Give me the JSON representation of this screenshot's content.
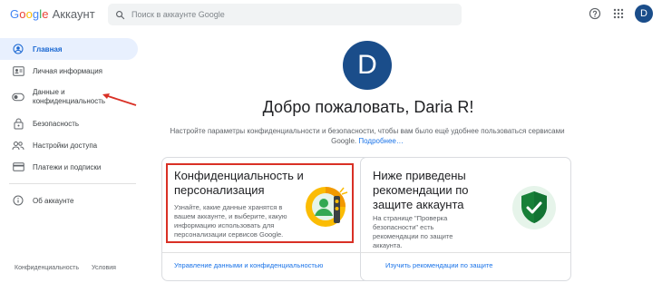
{
  "header": {
    "logo_google": "Google",
    "logo_account": "Аккаунт",
    "search_placeholder": "Поиск в аккаунте Google",
    "avatar_letter": "D"
  },
  "sidebar": {
    "items": [
      {
        "label": "Главная",
        "icon": "person-circle-icon",
        "active": true
      },
      {
        "label": "Личная информация",
        "icon": "id-card-icon"
      },
      {
        "label": "Данные и\nконфиденциальность",
        "icon": "toggle-icon"
      },
      {
        "label": "Безопасность",
        "icon": "lock-icon"
      },
      {
        "label": "Настройки доступа",
        "icon": "people-icon"
      },
      {
        "label": "Платежи и подписки",
        "icon": "credit-card-icon"
      },
      {
        "label": "Об аккаунте",
        "icon": "info-icon"
      }
    ],
    "footer": [
      "Конфиденциальность",
      "Условия"
    ]
  },
  "main": {
    "avatar_letter": "D",
    "welcome": "Добро пожаловать, Daria R!",
    "subtitle": "Настройте параметры конфиденциальности и безопасности, чтобы вам было ещё удобнее пользоваться сервисами Google.",
    "subtitle_link": "Подробнее…"
  },
  "cards": [
    {
      "title": "Конфиденциальность и персонализация",
      "desc": "Узнайте, какие данные хранятся в вашем аккаунте, и выберите, какую информацию использовать для персонализации сервисов Google.",
      "link": "Управление данными и конфиденциальностью",
      "icon": "privacy-illustration-icon"
    },
    {
      "title": "Ниже приведены рекомендации по защите аккаунта",
      "desc": "На странице \"Проверка безопасности\" есть рекомендации по защите аккаунта.",
      "link": "Изучить рекомендации по защите",
      "icon": "shield-check-icon"
    }
  ],
  "colors": {
    "accent": "#1a73e8",
    "avatar": "#1a4d8a",
    "annotation": "#d93025"
  }
}
